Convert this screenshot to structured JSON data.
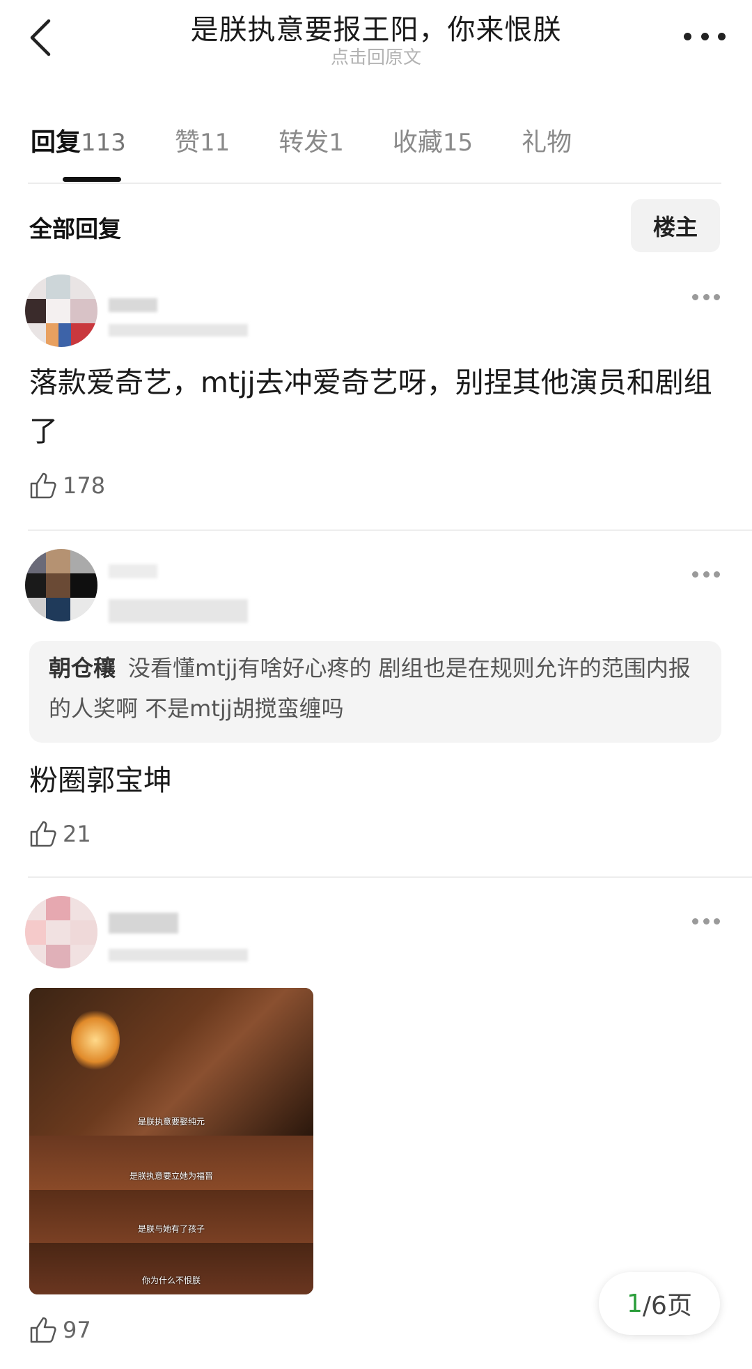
{
  "header": {
    "title": "是朕执意要报王阳，你来恨朕",
    "subtitle": "点击回原文"
  },
  "tabs": [
    {
      "label": "回复",
      "count": "113"
    },
    {
      "label": "赞",
      "count": "11"
    },
    {
      "label": "转发",
      "count": "1"
    },
    {
      "label": "收藏",
      "count": "15"
    },
    {
      "label": "礼物",
      "count": ""
    }
  ],
  "section": {
    "all_replies": "全部回复",
    "op_filter": "楼主"
  },
  "comments": [
    {
      "text": "落款爱奇艺，mtjj去冲爱奇艺呀，别捏其他演员和剧组了",
      "likes": "178"
    },
    {
      "quote_author": "朝仓穰",
      "quote_text": "没看懂mtjj有啥好心疼的 剧组也是在规则允许的范围内报的人奖啊 不是mtjj胡搅蛮缠吗",
      "text": "粉圈郭宝坤",
      "likes": "21"
    },
    {
      "image_captions": [
        "是朕执意要娶纯元",
        "是朕执意要立她为福晋",
        "是朕与她有了孩子",
        "你为什么不恨朕"
      ],
      "likes": "97"
    }
  ],
  "pager": {
    "current": "1",
    "total_label": "/6页"
  },
  "colors": {
    "accent_green": "#2a9d3a",
    "text_primary": "#1a1a1a",
    "text_secondary": "#8a8a8a"
  }
}
